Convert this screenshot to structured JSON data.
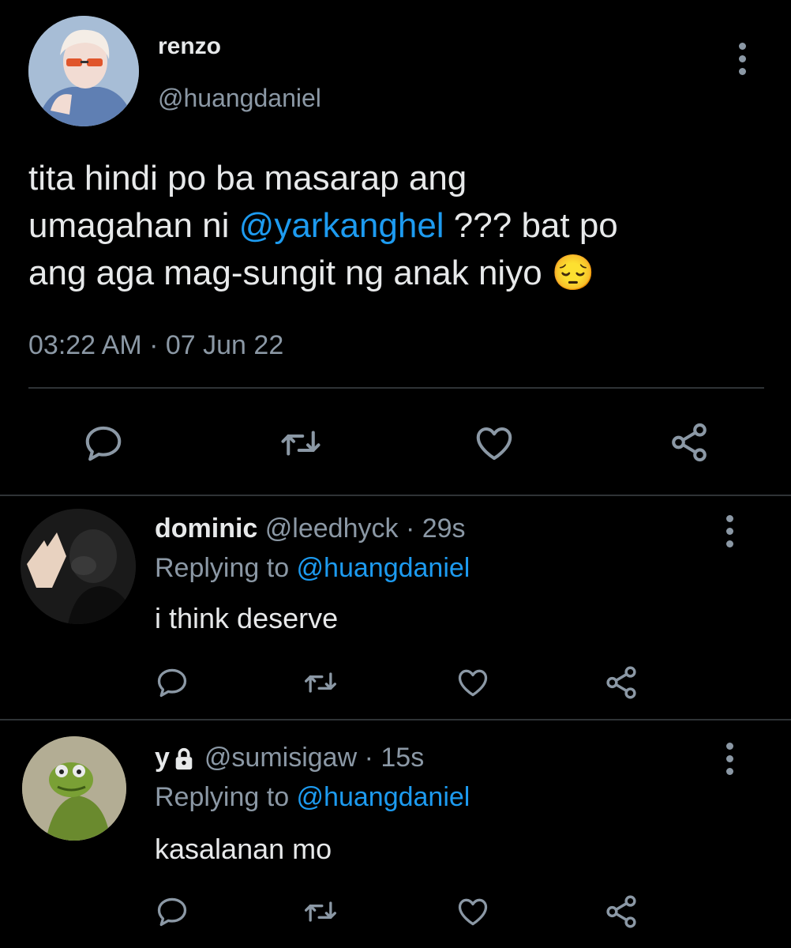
{
  "main_tweet": {
    "display_name": "renzo",
    "handle": "@huangdaniel",
    "text_part1": "tita hindi po ba masarap ang",
    "text_part2a": "umagahan ni ",
    "mention": "@yarkanghel",
    "text_part2b": " ??? bat po",
    "text_part3": "ang aga mag-sungit ng anak niyo ",
    "emoji": "😔",
    "time": "03:22 AM",
    "date_sep": " · ",
    "date": "07 Jun 22"
  },
  "replies": [
    {
      "display_name": "dominic",
      "handle": "@leedhyck",
      "sep": " · ",
      "age": "29s",
      "replying_label": "Replying to ",
      "replying_to": "@huangdaniel",
      "text": "i think deserve"
    },
    {
      "display_name": "y",
      "handle": "@sumisigaw",
      "sep": " · ",
      "age": "15s",
      "replying_label": "Replying to ",
      "replying_to": "@huangdaniel",
      "text": "kasalanan mo"
    }
  ],
  "icons": [
    "reply-icon",
    "retweet-icon",
    "like-icon",
    "share-icon",
    "more-icon",
    "lock-icon"
  ],
  "colors": {
    "background": "#000000",
    "text": "#e7e9ea",
    "muted": "#8b98a5",
    "link": "#1d9bf0",
    "divider": "#2f3336"
  }
}
